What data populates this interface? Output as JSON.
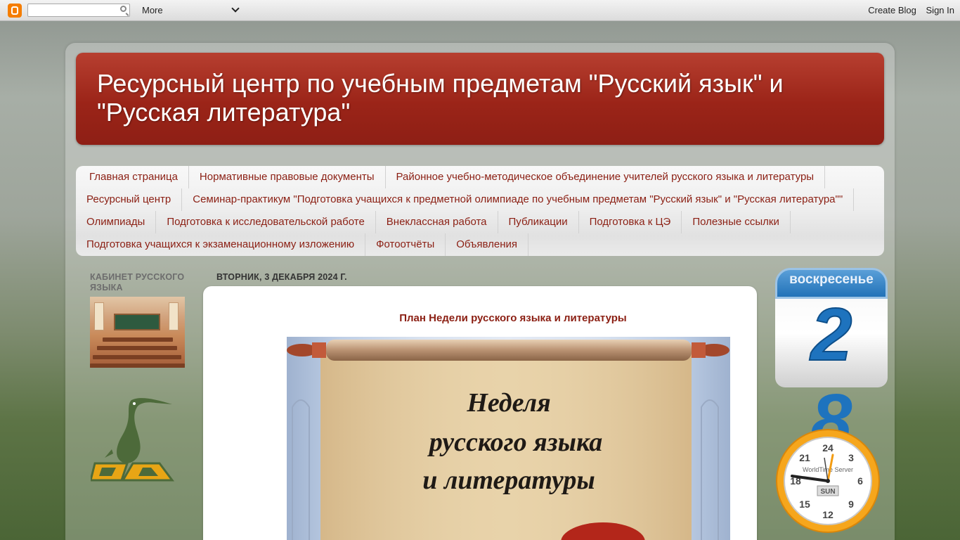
{
  "navbar": {
    "more_label": "More",
    "search_placeholder": "",
    "create_blog": "Create Blog",
    "sign_in": "Sign In"
  },
  "header": {
    "title": "Ресурсный центр по учебным предметам \"Русский язык\" и \"Русская литература\""
  },
  "tabs": {
    "row1": [
      "Главная страница",
      "Нормативные правовые документы",
      "Районное учебно-методическое объединение учителей русского языка и литературы"
    ],
    "row2": [
      "Ресурсный центр",
      "Семинар-практикум \"Подготовка учащихся к предметной олимпиаде по учебным предметам \"Русский язык\" и \"Русская литература\"\""
    ],
    "row3": [
      "Олимпиады",
      "Подготовка к исследовательской работе",
      "Внеклассная работа",
      "Публикации",
      "Подготовка к ЦЭ",
      "Полезные ссылки"
    ],
    "row4": [
      "Подготовка учащихся к экзаменационному изложению",
      "Фотоотчёты",
      "Объявления"
    ]
  },
  "sidebar": {
    "title": "КАБИНЕТ РУССКОГО ЯЗЫКА"
  },
  "post": {
    "date": "ВТОРНИК, 3 ДЕКАБРЯ 2024 Г.",
    "title": "План Недели русского языка и литературы",
    "image_text": [
      "Неделя",
      "русского языка",
      "и литературы"
    ]
  },
  "calendar": {
    "weekday": "воскресенье",
    "day_digit1": "2",
    "day_digit2": "8"
  },
  "clock": {
    "brand": "WorldTime Server",
    "day": "SUN",
    "numbers": [
      "24",
      "3",
      "6",
      "9",
      "12",
      "15",
      "18",
      "21"
    ]
  },
  "colors": {
    "header_red": "#9b2418",
    "tab_text": "#8b1f13",
    "calendar_blue": "#1e73be",
    "clock_orange": "#f39c12"
  }
}
